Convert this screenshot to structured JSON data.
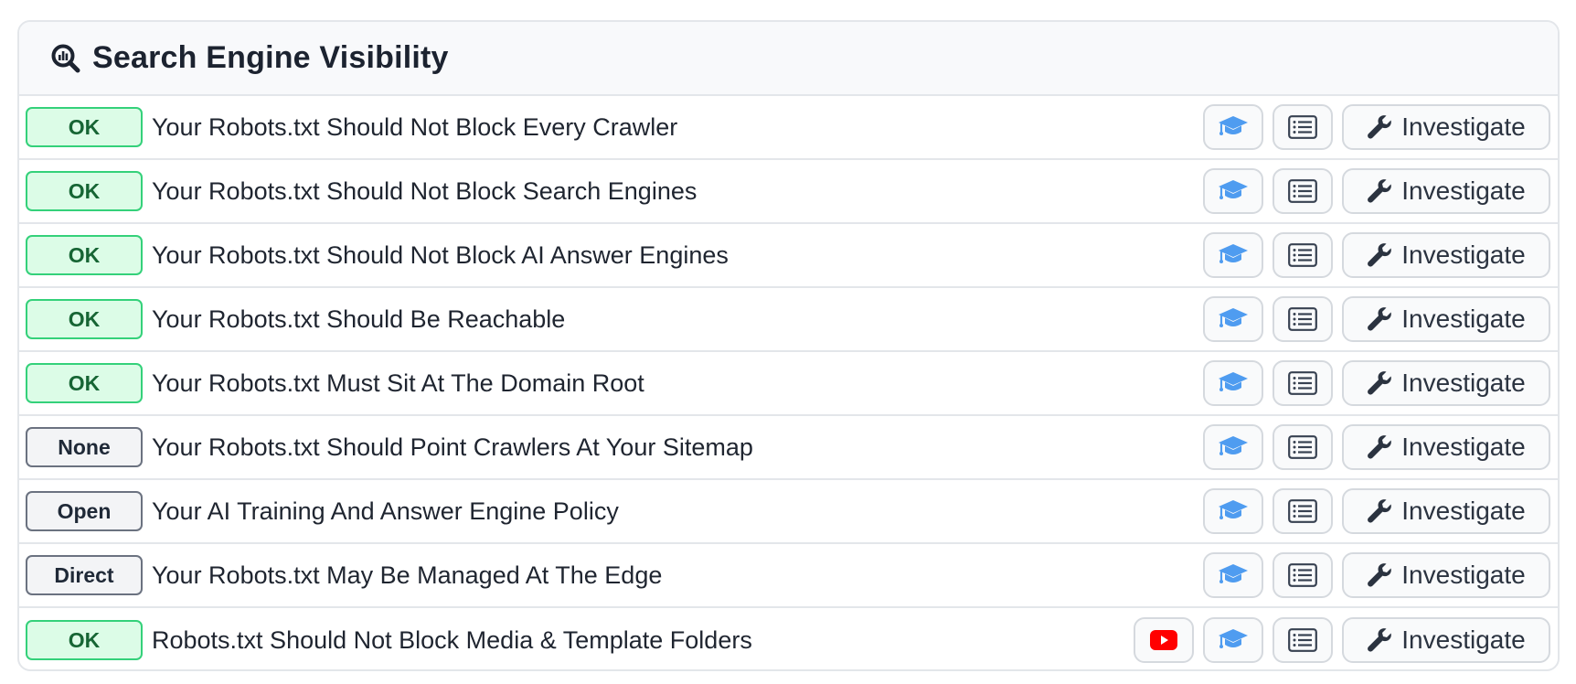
{
  "panel": {
    "title": "Search Engine Visibility",
    "title_icon": "search-analytics-icon"
  },
  "colors": {
    "ok_bg": "#dcfce7",
    "ok_border": "#34d17a",
    "ok_text": "#166534",
    "neutral_bg": "#f3f4f6",
    "neutral_border": "#6b7280",
    "learn_icon": "#4f9cf0",
    "youtube_red": "#ff0000"
  },
  "actions": {
    "investigate_label": "Investigate",
    "learn_icon": "graduation-cap-icon",
    "details_icon": "list-icon",
    "investigate_icon": "wrench-icon",
    "video_icon": "youtube-icon"
  },
  "rows": [
    {
      "status": "OK",
      "status_type": "ok",
      "label": "Your Robots.txt Should Not Block Every Crawler",
      "has_video": false
    },
    {
      "status": "OK",
      "status_type": "ok",
      "label": "Your Robots.txt Should Not Block Search Engines",
      "has_video": false
    },
    {
      "status": "OK",
      "status_type": "ok",
      "label": "Your Robots.txt Should Not Block AI Answer Engines",
      "has_video": false
    },
    {
      "status": "OK",
      "status_type": "ok",
      "label": "Your Robots.txt Should Be Reachable",
      "has_video": false
    },
    {
      "status": "OK",
      "status_type": "ok",
      "label": "Your Robots.txt Must Sit At The Domain Root",
      "has_video": false
    },
    {
      "status": "None",
      "status_type": "neutral",
      "label": "Your Robots.txt Should Point Crawlers At Your Sitemap",
      "has_video": false
    },
    {
      "status": "Open",
      "status_type": "neutral",
      "label": "Your AI Training And Answer Engine Policy",
      "has_video": false
    },
    {
      "status": "Direct",
      "status_type": "neutral",
      "label": "Your Robots.txt May Be Managed At The Edge",
      "has_video": false
    },
    {
      "status": "OK",
      "status_type": "ok",
      "label": "Robots.txt Should Not Block Media & Template Folders",
      "has_video": true
    }
  ]
}
